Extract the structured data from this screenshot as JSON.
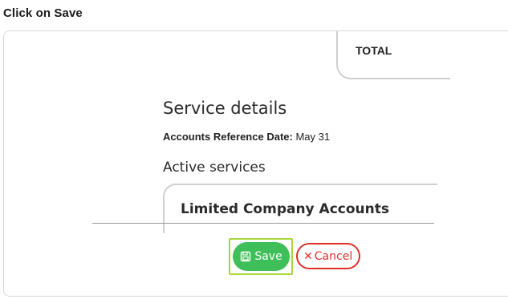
{
  "instruction": {
    "text": "Click on  Save"
  },
  "total_card": {
    "label": "TOTAL"
  },
  "service_details": {
    "title": "Service details",
    "ref_key": "Accounts Reference Date:",
    "ref_value": " May 31",
    "active_title": "Active services",
    "services": [
      {
        "name": "Limited Company Accounts"
      }
    ]
  },
  "actions": {
    "save_label": "Save",
    "save_icon": "floppy-disk-icon",
    "cancel_label": "Cancel",
    "cancel_icon": "close-icon"
  },
  "colors": {
    "save_bg": "#3fbf5a",
    "cancel": "#e0302b",
    "highlight": "#a6d63a"
  }
}
